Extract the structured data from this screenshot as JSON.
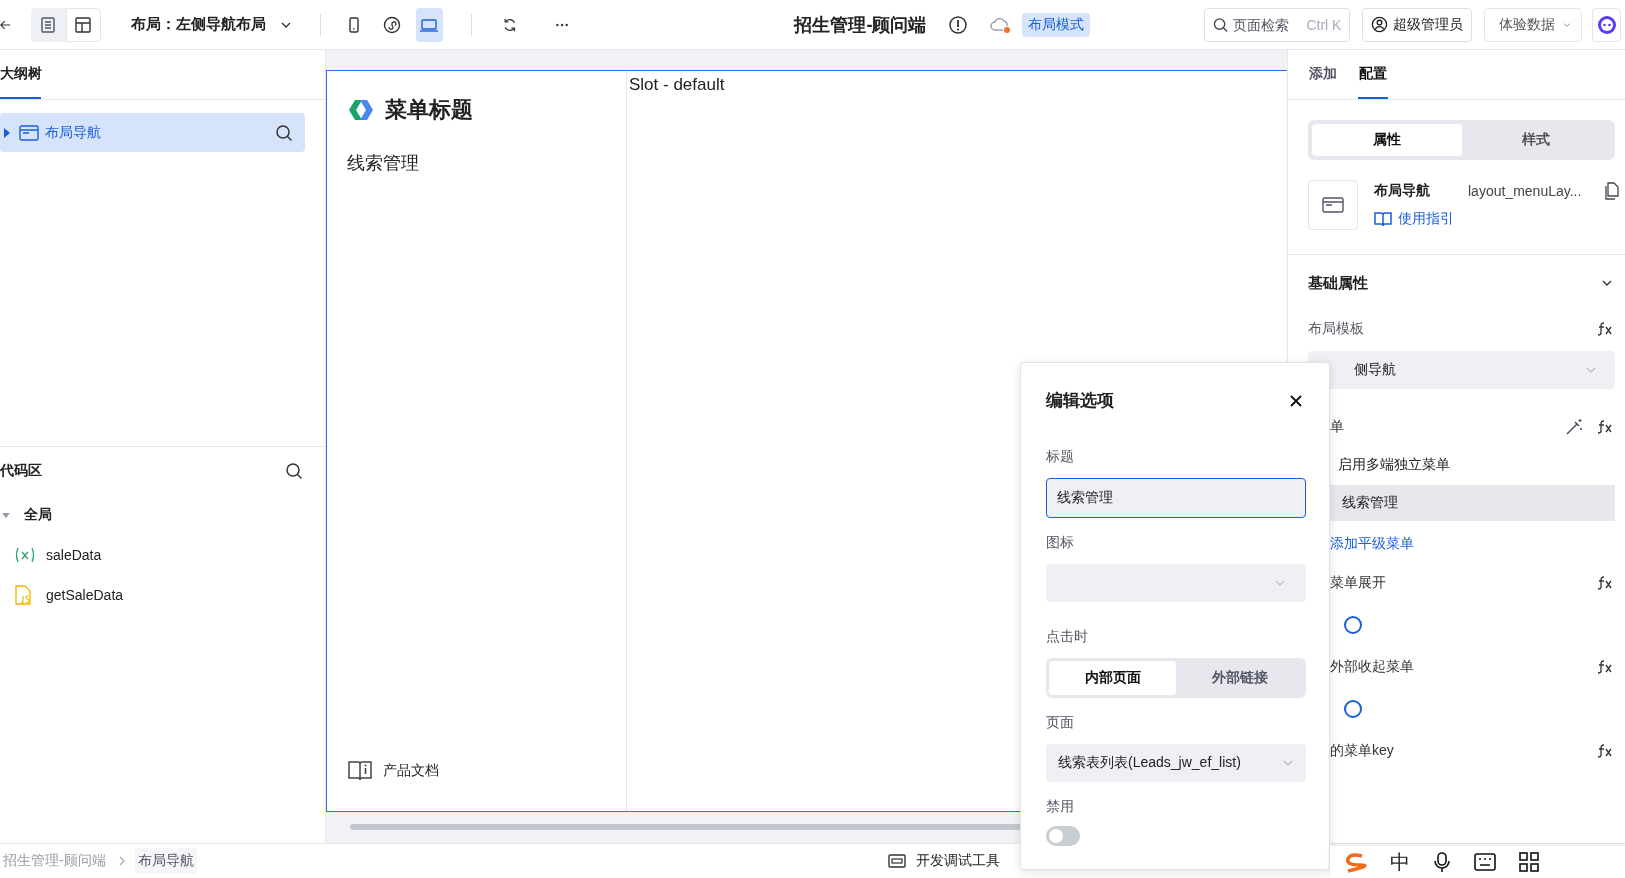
{
  "toolbar": {
    "view_modes": [
      {
        "kind": "outline",
        "selected": true
      },
      {
        "kind": "layout",
        "selected": false
      }
    ],
    "layout_selector": "布局：左侧导航布局",
    "devices": [
      {
        "kind": "mobile",
        "selected": false
      },
      {
        "kind": "mini",
        "selected": false
      },
      {
        "kind": "desktop",
        "selected": true
      }
    ],
    "app_title": "招生管理-顾问端",
    "mode_badge": "布局模式",
    "search": {
      "placeholder": "页面检索",
      "shortcut": "Ctrl K"
    },
    "user": "超级管理员",
    "data_selector": "体验数据"
  },
  "left_panel": {
    "tabs": [
      {
        "label": "大纲树",
        "selected": true
      }
    ],
    "tree": [
      {
        "label": "布局导航",
        "selected": true,
        "expanded": false
      }
    ],
    "code_area": {
      "title": "代码区",
      "groups": [
        {
          "label": "全局",
          "expanded": true,
          "children": [
            {
              "label": "saleData",
              "kind": "variable"
            },
            {
              "label": "getSaleData",
              "kind": "function"
            }
          ]
        }
      ]
    }
  },
  "canvas": {
    "menu_title": "菜单标题",
    "menu_items": [
      {
        "label": "线索管理"
      }
    ],
    "footer_link": "产品文档",
    "slot_label": "Slot - default"
  },
  "right_panel": {
    "tabs": [
      {
        "label": "添加",
        "selected": false
      },
      {
        "label": "配置",
        "selected": true
      }
    ],
    "segments": [
      {
        "label": "属性",
        "selected": true
      },
      {
        "label": "样式",
        "selected": false
      }
    ],
    "component": {
      "name": "布局导航",
      "id": "layout_menuLay...",
      "guide": "使用指引"
    },
    "section": {
      "title": "基础属性",
      "expanded": true
    },
    "layout_template": {
      "label": "布局模板",
      "value": "侧导航"
    },
    "menu": {
      "label": "单",
      "multi_end": "启用多端独立菜单",
      "items": [
        "线索管理"
      ],
      "add": "添加平级菜单"
    },
    "toggles": [
      {
        "label": "菜单展开",
        "on": false
      },
      {
        "label": "外部收起菜单",
        "on": false
      }
    ],
    "selected_key": {
      "label": "的菜单key"
    }
  },
  "dialog": {
    "title": "编辑选项",
    "title_label": "标题",
    "title_value": "线索管理",
    "icon_label": "图标",
    "click_label": "点击时",
    "click_options": [
      {
        "label": "内部页面",
        "selected": true
      },
      {
        "label": "外部链接",
        "selected": false
      }
    ],
    "page_label": "页面",
    "page_value": "线索表列表(Leads_jw_ef_list)",
    "disabled_label": "禁用",
    "disabled_on": false
  },
  "status_bar": {
    "breadcrumbs": [
      "招生管理-顾问端",
      "布局导航"
    ],
    "devtools": "开发调试工具"
  },
  "ime": {
    "mode": "中"
  }
}
